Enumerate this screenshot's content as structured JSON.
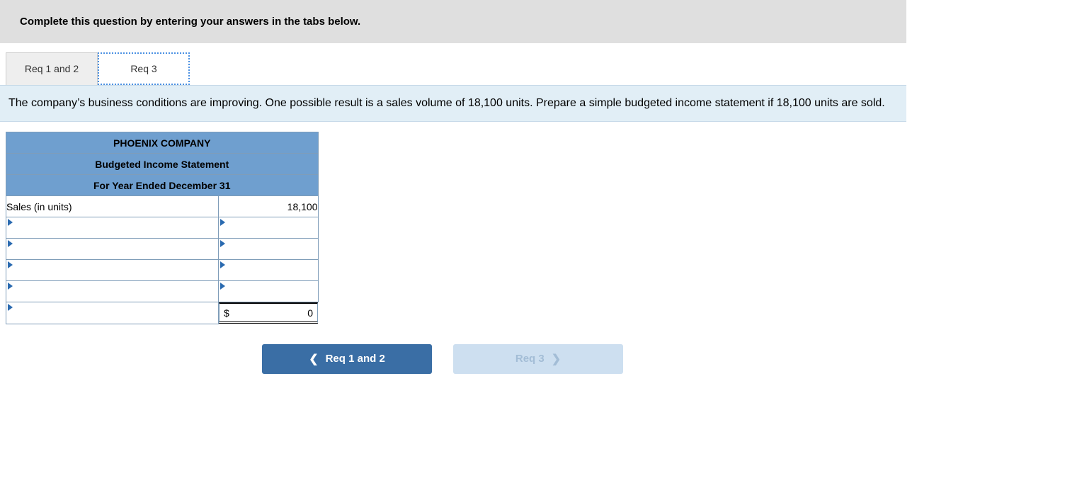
{
  "instruction": "Complete this question by entering your answers in the tabs below.",
  "tabs": {
    "t1": "Req 1 and 2",
    "t2": "Req 3"
  },
  "prompt": "The company’s business conditions are improving. One possible result is a sales volume of 18,100 units. Prepare a simple budgeted income statement if 18,100 units are sold.",
  "table": {
    "h1": "PHOENIX COMPANY",
    "h2": "Budgeted Income Statement",
    "h3": "For Year Ended December 31",
    "row_sales_label": "Sales (in units)",
    "row_sales_value": "18,100",
    "total_currency": "$",
    "total_value": "0"
  },
  "nav": {
    "prev": "Req 1 and 2",
    "next": "Req 3"
  }
}
